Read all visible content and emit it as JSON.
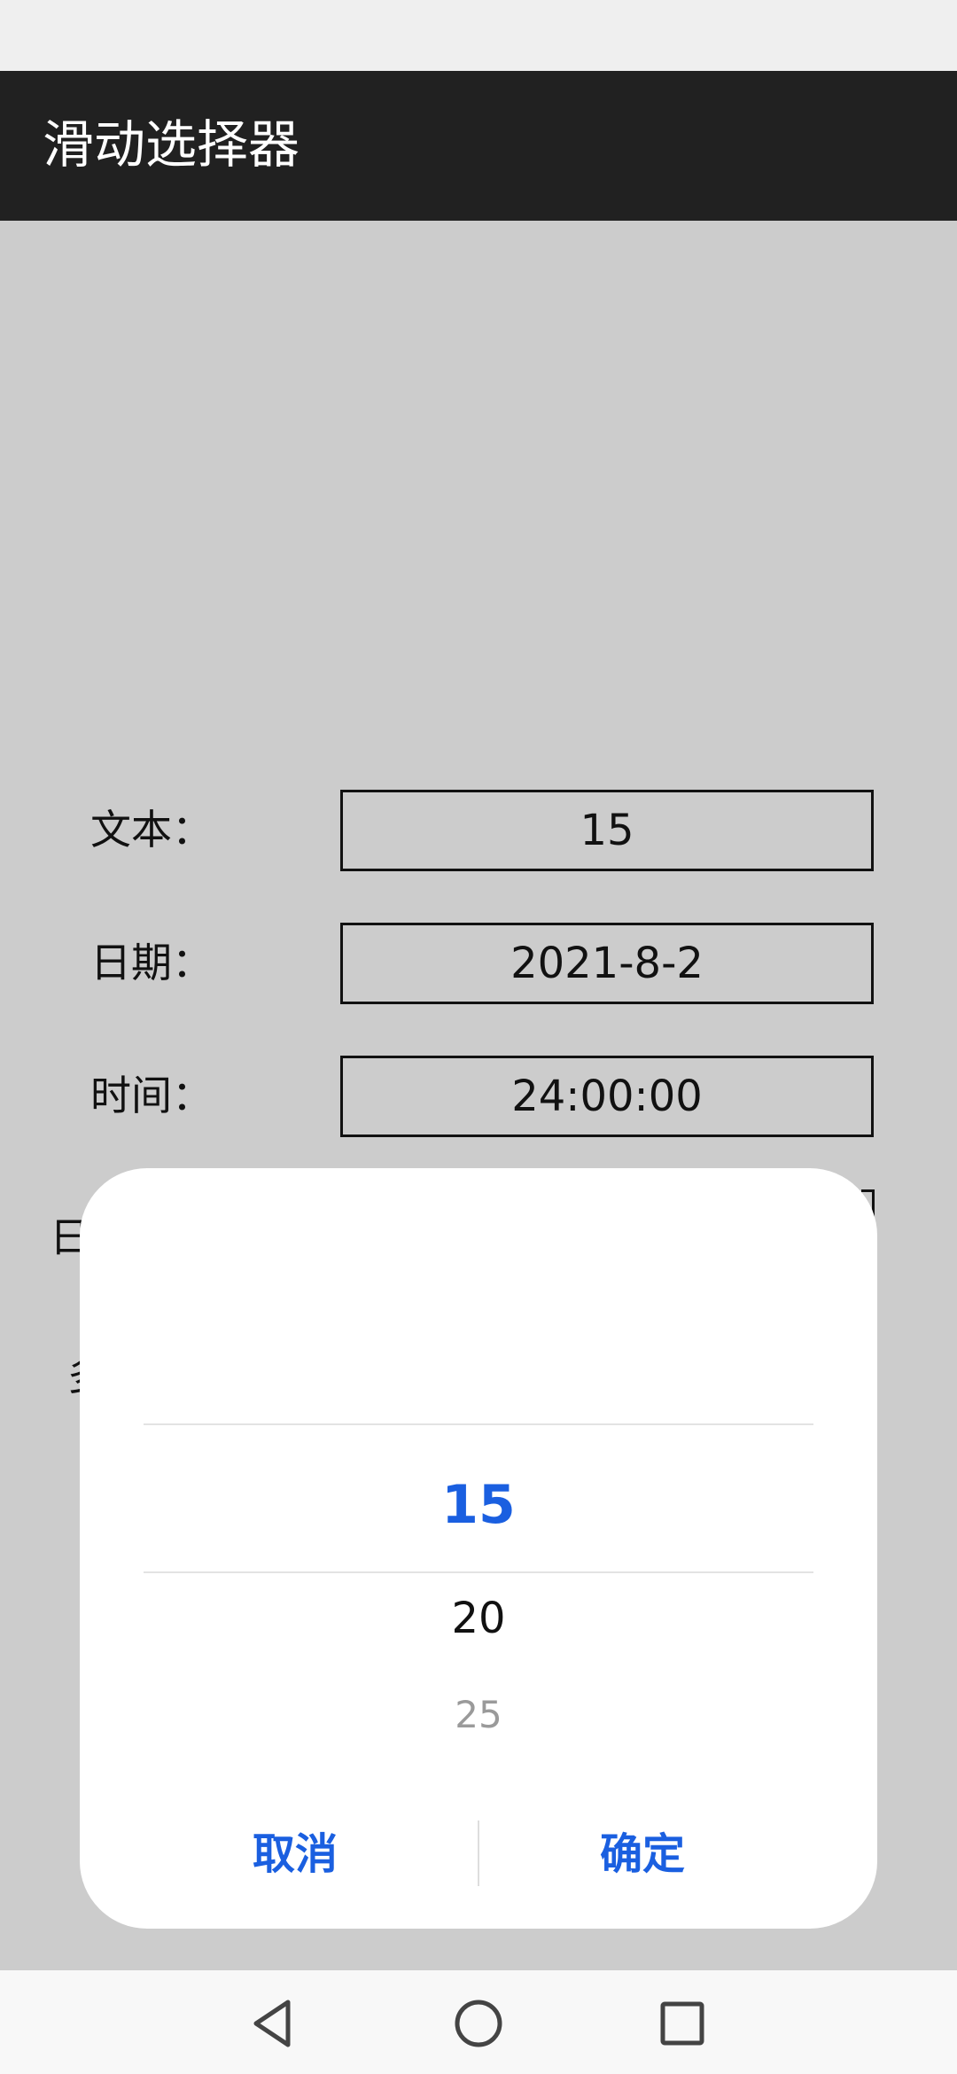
{
  "app": {
    "title": "滑动选择器"
  },
  "form": {
    "rows": [
      {
        "label": "文本：",
        "value": "15"
      },
      {
        "label": "日期：",
        "value": "2021-8-2"
      },
      {
        "label": "时间：",
        "value": "24:00:00"
      }
    ],
    "hidden_row_labels_peek": [
      "日",
      "多"
    ]
  },
  "picker": {
    "selected": "15",
    "options_below": [
      "20",
      "25"
    ]
  },
  "dialog": {
    "cancel_label": "取消",
    "confirm_label": "确定"
  },
  "nav": {
    "icons": [
      "back-icon",
      "home-icon",
      "recents-icon"
    ]
  },
  "colors": {
    "accent": "#1a5fe0",
    "app_bar": "#212121",
    "background": "#cccccc"
  }
}
